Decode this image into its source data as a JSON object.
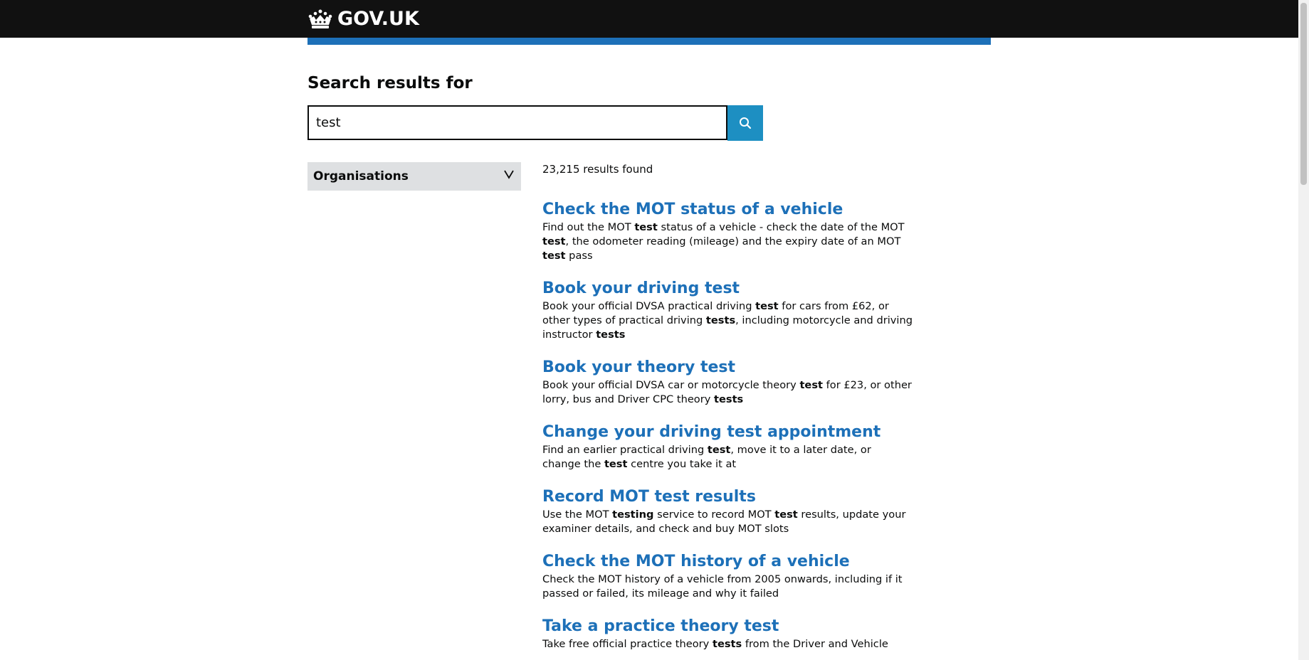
{
  "header": {
    "logo_text": "GOV.UK"
  },
  "search": {
    "heading": "Search results for",
    "query": "test",
    "button_label": "Search"
  },
  "filters": {
    "organisations_label": "Organisations"
  },
  "results_count": "23,215 results found",
  "results": [
    {
      "title": "Check the MOT status of a vehicle",
      "description": [
        {
          "t": "Find out the MOT ",
          "b": false
        },
        {
          "t": "test",
          "b": true
        },
        {
          "t": " status of a vehicle - check the date of the MOT ",
          "b": false
        },
        {
          "t": "test",
          "b": true
        },
        {
          "t": ", the odometer reading (mileage) and the expiry date of an MOT ",
          "b": false
        },
        {
          "t": "test",
          "b": true
        },
        {
          "t": " pass",
          "b": false
        }
      ]
    },
    {
      "title": "Book your driving test",
      "description": [
        {
          "t": "Book your official DVSA practical driving ",
          "b": false
        },
        {
          "t": "test",
          "b": true
        },
        {
          "t": " for cars from £62, or other types of practical driving ",
          "b": false
        },
        {
          "t": "tests",
          "b": true
        },
        {
          "t": ", including motorcycle and driving instructor ",
          "b": false
        },
        {
          "t": "tests",
          "b": true
        }
      ]
    },
    {
      "title": "Book your theory test",
      "description": [
        {
          "t": "Book your official DVSA car or motorcycle theory ",
          "b": false
        },
        {
          "t": "test",
          "b": true
        },
        {
          "t": " for £23, or other lorry, bus and Driver CPC theory ",
          "b": false
        },
        {
          "t": "tests",
          "b": true
        }
      ]
    },
    {
      "title": "Change your driving test appointment",
      "description": [
        {
          "t": "Find an earlier practical driving ",
          "b": false
        },
        {
          "t": "test",
          "b": true
        },
        {
          "t": ", move it to a later date, or change the ",
          "b": false
        },
        {
          "t": "test",
          "b": true
        },
        {
          "t": " centre you take it at",
          "b": false
        }
      ]
    },
    {
      "title": "Record MOT test results",
      "description": [
        {
          "t": "Use the MOT ",
          "b": false
        },
        {
          "t": "testing",
          "b": true
        },
        {
          "t": " service to record MOT ",
          "b": false
        },
        {
          "t": "test",
          "b": true
        },
        {
          "t": " results, update your examiner details, and check and buy MOT slots",
          "b": false
        }
      ]
    },
    {
      "title": "Check the MOT history of a vehicle",
      "description": [
        {
          "t": "Check the MOT history of a vehicle from 2005 onwards, including if it passed or failed, its mileage and why it failed",
          "b": false
        }
      ]
    },
    {
      "title": "Take a practice theory test",
      "description": [
        {
          "t": "Take free official practice theory ",
          "b": false
        },
        {
          "t": "tests",
          "b": true
        },
        {
          "t": " from the Driver and Vehicle",
          "b": false
        }
      ]
    }
  ],
  "colors": {
    "header_bg": "#111111",
    "accent_blue": "#1d70b8",
    "search_button": "#1d8fc2",
    "facet_bg": "#dee0e2",
    "text": "#0b0c0c"
  },
  "icons": {
    "logo": "crown-icon",
    "search_button": "search-icon",
    "facet_toggle": "chevron-down-icon"
  }
}
